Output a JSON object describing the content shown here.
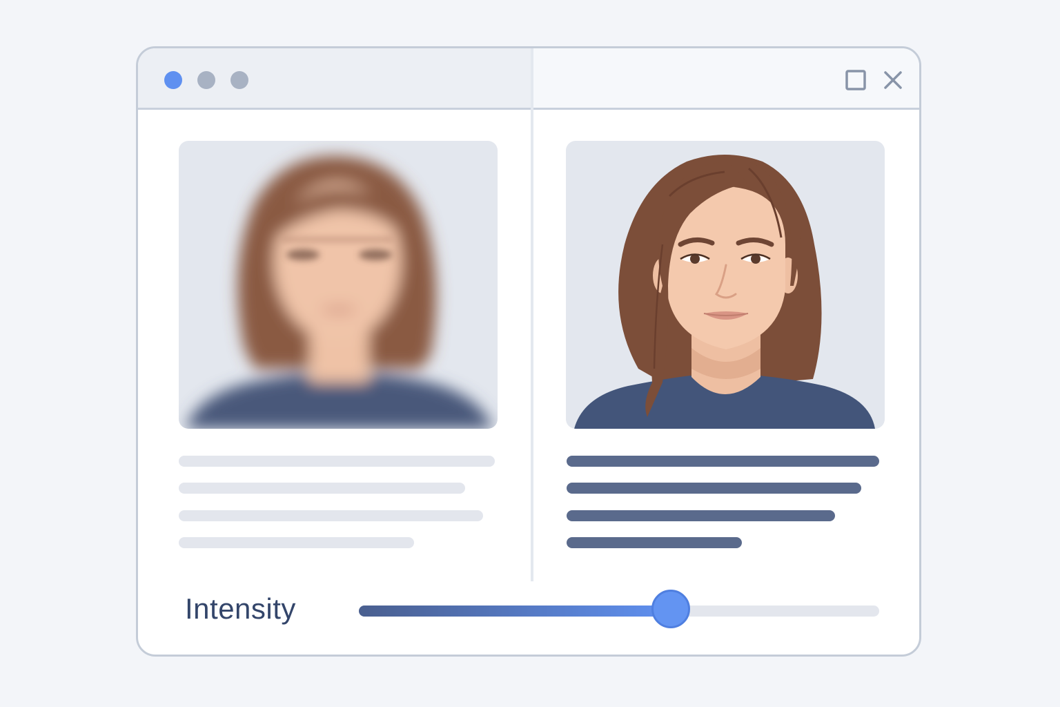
{
  "window": {
    "controls": [
      "maximize-icon",
      "close-icon"
    ],
    "dots": [
      "window-dot-blue",
      "window-dot-gray",
      "window-dot-gray"
    ]
  },
  "panels": {
    "left": {
      "state": "blurred",
      "text_line_count": 4
    },
    "right": {
      "state": "sharp",
      "text_line_count": 4
    }
  },
  "slider": {
    "label": "Intensity",
    "value_fraction": 0.6
  },
  "colors": {
    "accent": "#5f90f0",
    "hair": "#7c4e39",
    "skin": "#f2c4a8",
    "shirt": "#43557a",
    "text_dark": "#33456a",
    "line_sharp": "#5a6a8c",
    "line_faded": "#e3e6ed"
  }
}
